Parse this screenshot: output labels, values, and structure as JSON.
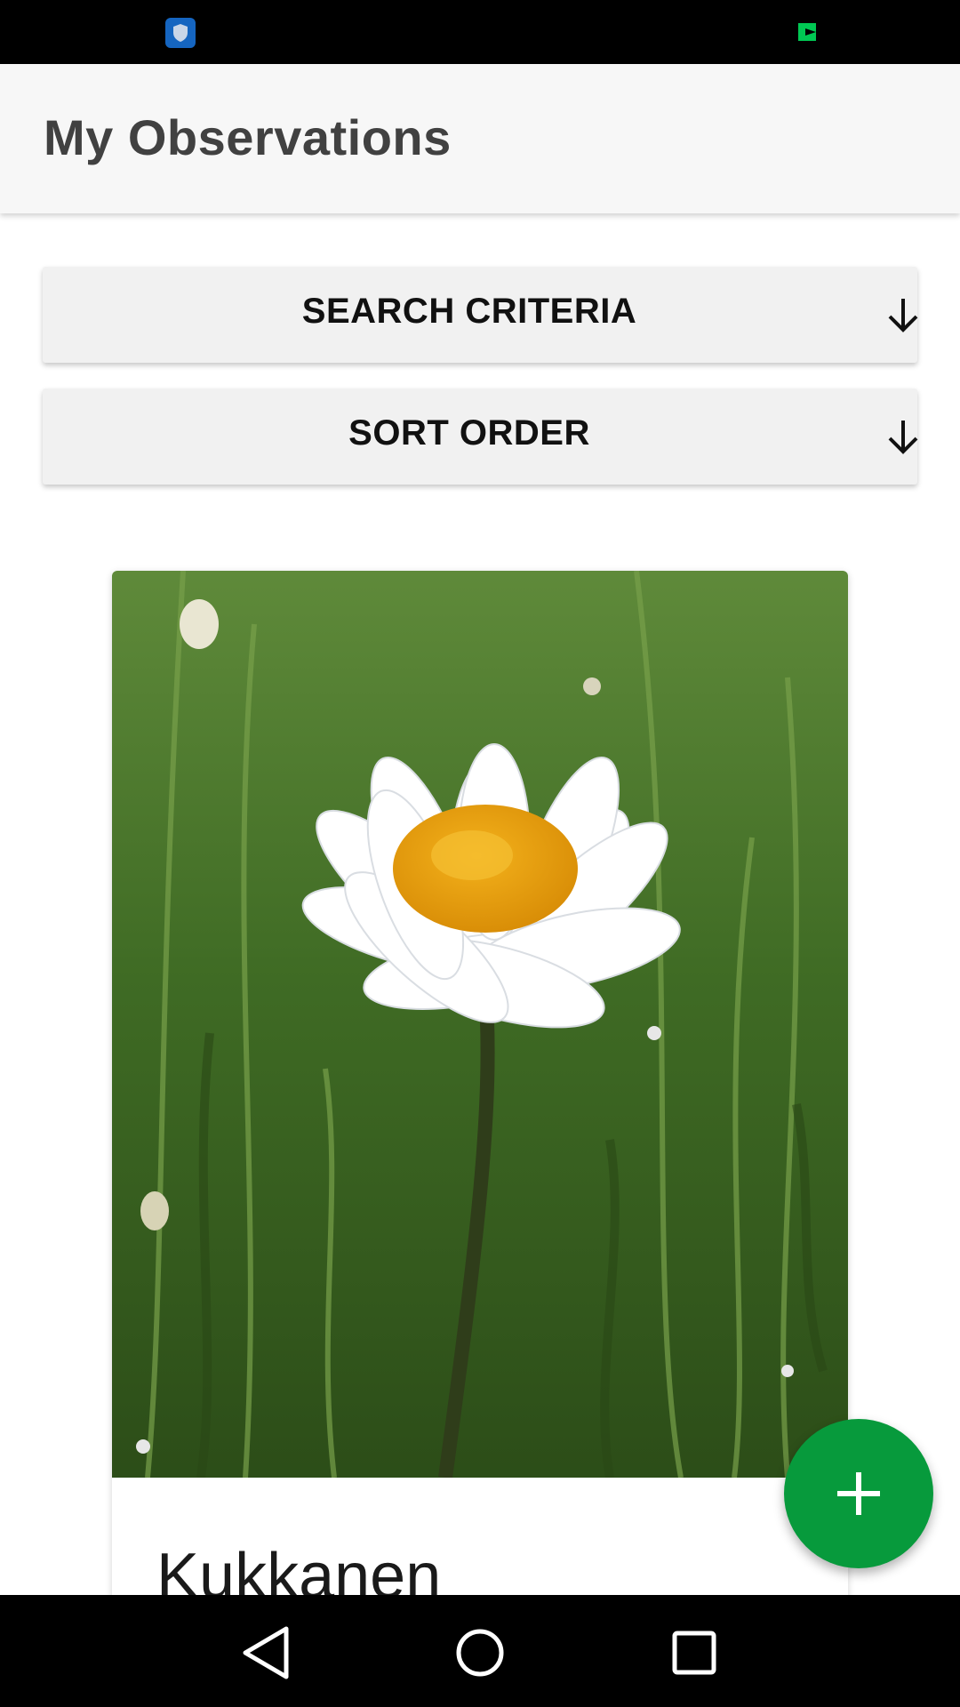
{
  "status_bar": {
    "left_icon": "shield-icon",
    "right_icon": "green-flag-icon"
  },
  "app_bar": {
    "title": "My Observations"
  },
  "sections": {
    "search_criteria": {
      "label": "SEARCH CRITERIA",
      "icon": "arrow-down-icon"
    },
    "sort_order": {
      "label": "SORT ORDER",
      "icon": "arrow-down-icon"
    }
  },
  "observations": [
    {
      "title": "Kukkanen",
      "photo": "daisy-photo"
    }
  ],
  "fab": {
    "icon": "plus-icon"
  },
  "nav_bar": {
    "back_icon": "back-triangle-icon",
    "home_icon": "home-circle-icon",
    "recents_icon": "recents-square-icon"
  },
  "colors": {
    "status_bar": "#000000",
    "app_bar": "#f7f7f7",
    "title_text": "#414141",
    "section_bg": "#f1f1f1",
    "fab": "#079a3c",
    "shield": "#1565c0",
    "flag": "#00c853"
  }
}
